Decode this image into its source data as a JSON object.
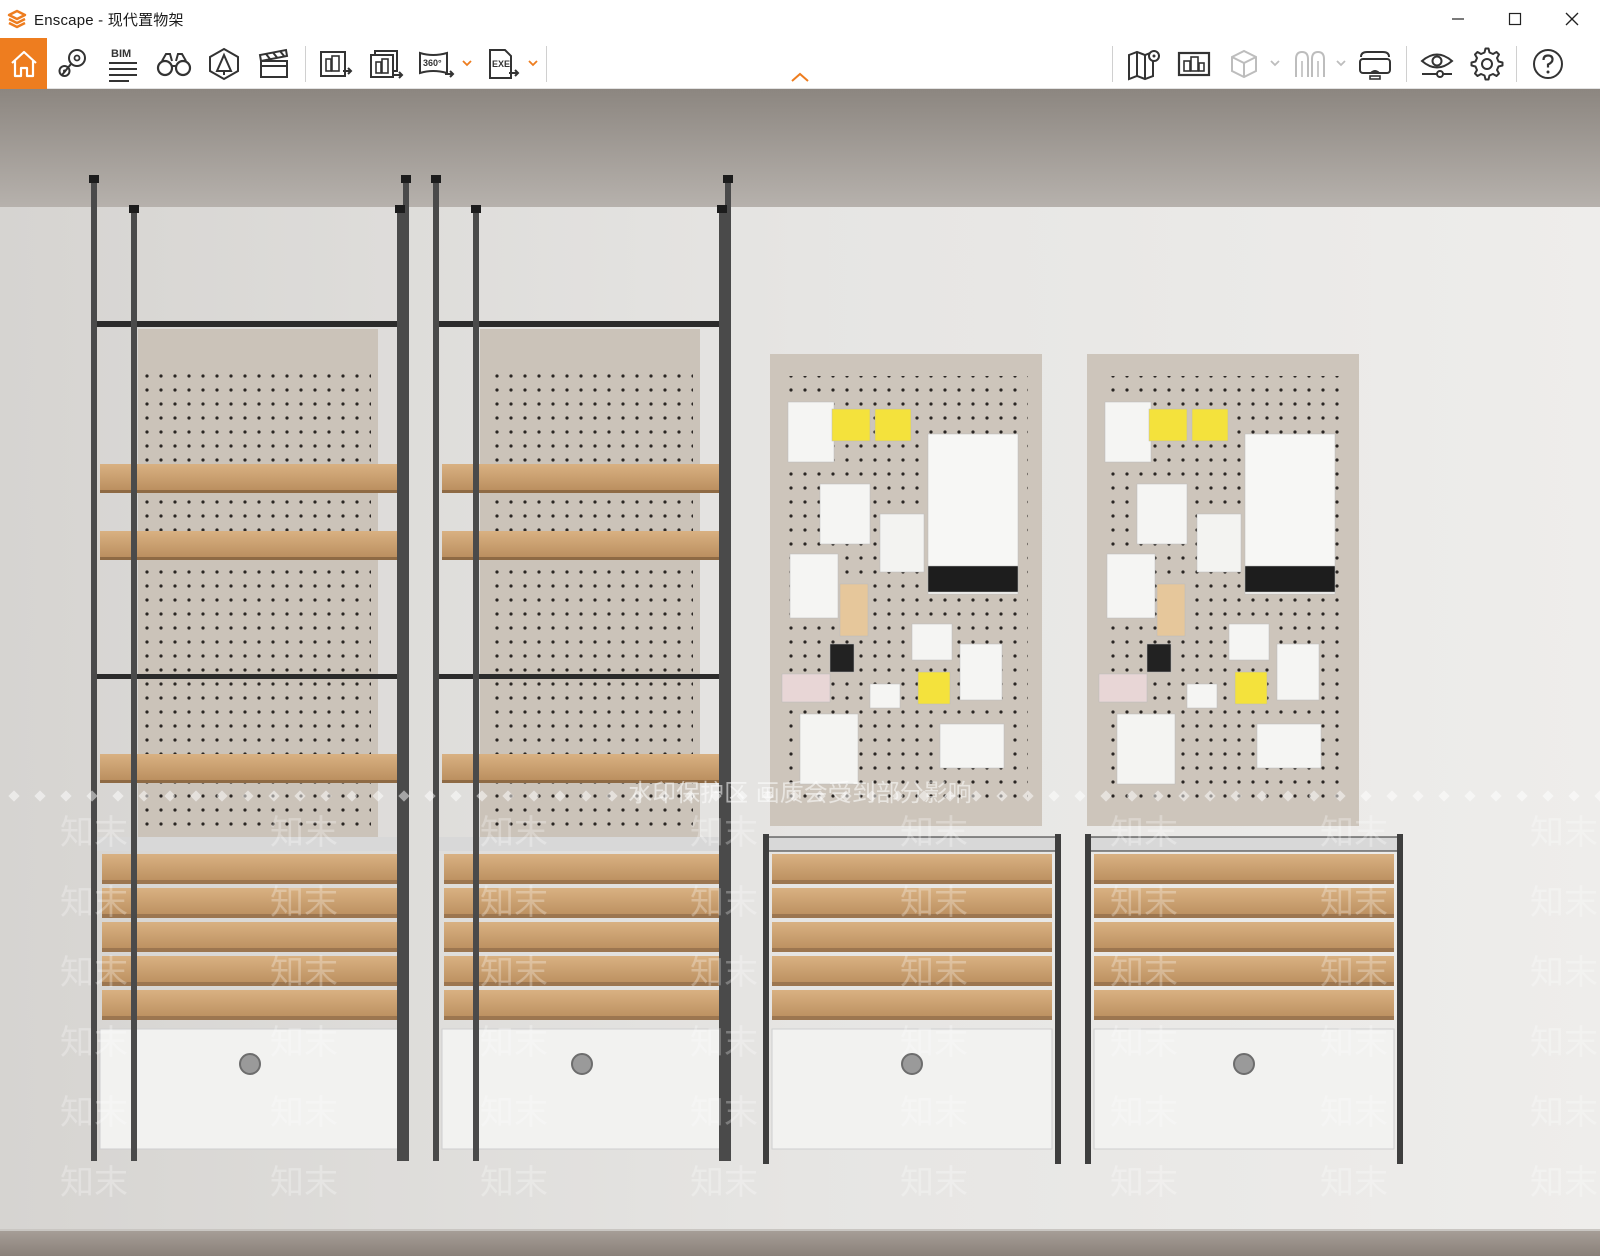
{
  "window": {
    "title": "Enscape - 现代置物架",
    "controls": [
      "minimize",
      "maximize",
      "close"
    ]
  },
  "toolbar": {
    "left_tools": [
      {
        "name": "home",
        "icon": "house-icon",
        "active": true
      },
      {
        "name": "view-management",
        "icon": "location-pin-icon"
      },
      {
        "name": "bim",
        "icon": "bim-list-icon",
        "label": "BIM"
      },
      {
        "name": "walk-mode",
        "icon": "binoculars-icon"
      },
      {
        "name": "asset-library",
        "icon": "asset-library-icon"
      },
      {
        "name": "video-editor",
        "icon": "clapperboard-icon"
      }
    ],
    "export_tools": [
      {
        "name": "screenshot",
        "icon": "export-image-icon"
      },
      {
        "name": "batch-render",
        "icon": "batch-render-icon"
      },
      {
        "name": "panorama",
        "icon": "panorama-360-icon",
        "label": "360°",
        "dropdown": true
      },
      {
        "name": "exe-export",
        "icon": "exe-export-icon",
        "label": "EXE",
        "dropdown": true
      }
    ],
    "right_tools": [
      {
        "name": "map",
        "icon": "map-icon"
      },
      {
        "name": "web-standalone",
        "icon": "building-screen-icon"
      },
      {
        "name": "cube",
        "icon": "cube-icon",
        "dropdown": true,
        "disabled": true
      },
      {
        "name": "people",
        "icon": "people-icon",
        "dropdown": true,
        "disabled": true
      },
      {
        "name": "vr-headset",
        "icon": "vr-headset-icon"
      },
      {
        "name": "visual-settings",
        "icon": "eye-settings-icon"
      },
      {
        "name": "general-settings",
        "icon": "gear-icon"
      },
      {
        "name": "help",
        "icon": "help-icon"
      }
    ],
    "accent_color": "#ee7d1f"
  },
  "viewport": {
    "watermark_text": "水印保护区  画质会受到部分影响",
    "watermark_repeat": "知末"
  }
}
